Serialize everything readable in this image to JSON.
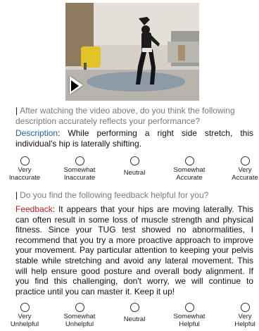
{
  "video": {
    "alt": "Person performing a stretch in a living room"
  },
  "question1": {
    "text": "After watching the video above, do you think the following description accurately reflects your performance?"
  },
  "description": {
    "label": "Description",
    "text": "While performing a right side stretch, this individual's hip is laterally shifting."
  },
  "accuracy_scale": [
    {
      "line1": "Very",
      "line2": "Inaccurate"
    },
    {
      "line1": "Somewhat",
      "line2": "Inaccurate"
    },
    {
      "line1": "Neutral",
      "line2": ""
    },
    {
      "line1": "Somewhat",
      "line2": "Accurate"
    },
    {
      "line1": "Very",
      "line2": "Accurate"
    }
  ],
  "question2": {
    "text": "Do you find the following feedback helpful for you?"
  },
  "feedback": {
    "label": "Feedback",
    "text": "It appears that your hips are moving laterally. This can often result in some loss of muscle strength and physical fitness. Since your TUG test showed no abnormalities, I recommend that you try a more proactive approach to improve your movement. Pay particular attention to keeping your pelvis stable while stretching and avoid any lateral movement. This will help ensure good posture and overall body alignment. If you find this challenging, don't worry, we will continue to practice until you can master it. Keep it up!"
  },
  "helpful_scale": [
    {
      "line1": "Very",
      "line2": "Unhelpful"
    },
    {
      "line1": "Somewhat",
      "line2": "Unhelpful"
    },
    {
      "line1": "Neutral",
      "line2": ""
    },
    {
      "line1": "Somewhat",
      "line2": "Helpful"
    },
    {
      "line1": "Very",
      "line2": "Helpful"
    }
  ]
}
